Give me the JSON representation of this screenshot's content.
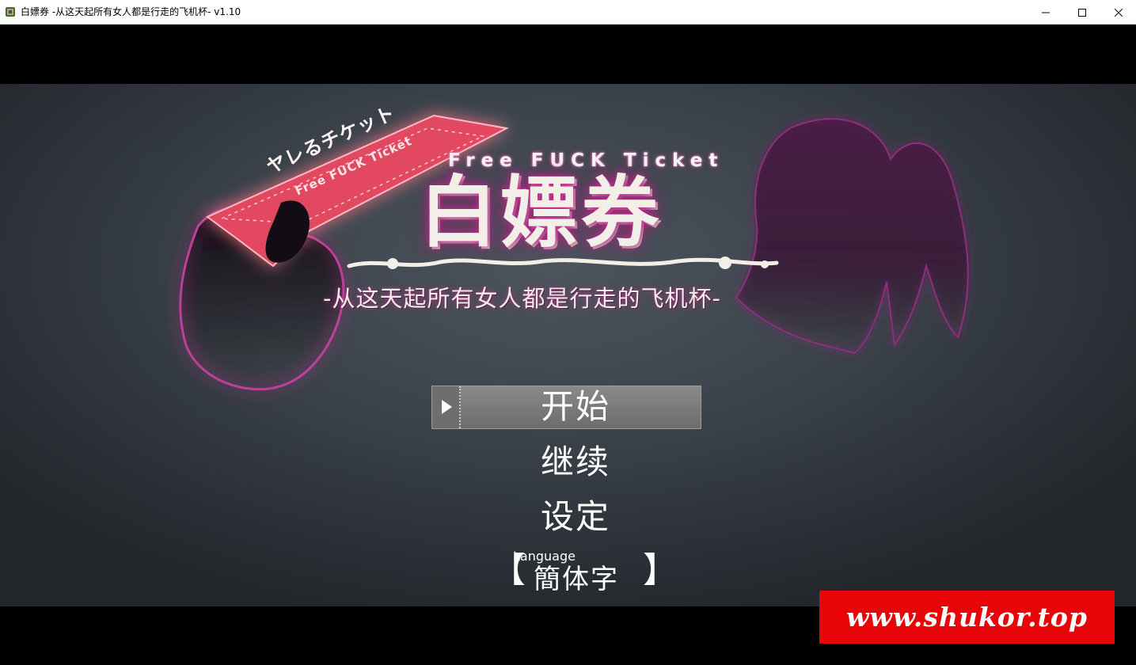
{
  "window": {
    "title": "白嫖券 -从这天起所有女人都是行走的飞机杯- v1.10",
    "controls": [
      "minimize-icon",
      "maximize-icon",
      "close-icon"
    ]
  },
  "logo": {
    "tagline": "Free FUCK Ticket",
    "title": "白嫖券",
    "subtitle": "-从这天起所有女人都是行走的飞机杯-",
    "ticket_text": "ヤレるチケット",
    "ticket_subtext": "Free FUCK Ticket"
  },
  "menu": {
    "items": [
      {
        "label": "开始",
        "selected": true
      },
      {
        "label": "继续",
        "selected": false
      },
      {
        "label": "设定",
        "selected": false
      }
    ],
    "language": {
      "label": "Language",
      "value": "簡体字",
      "bracket_left": "【",
      "bracket_right": "】"
    }
  },
  "watermark": {
    "text": "www.shukor.top"
  },
  "colors": {
    "accent_glow": "#c22b8f",
    "ticket": "#e4485e",
    "watermark_bg": "#e8050a",
    "selection_bg": "#7a7a7a"
  }
}
